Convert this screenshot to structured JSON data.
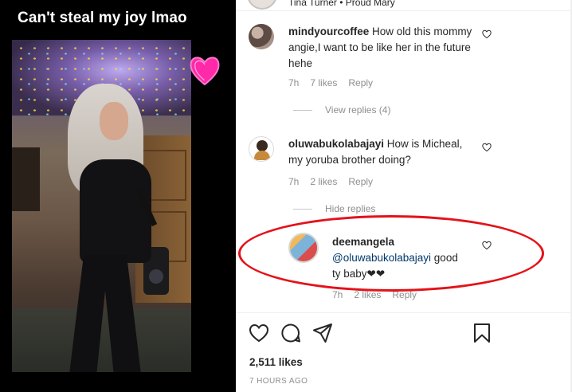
{
  "media": {
    "caption": "Can't steal my joy lmao"
  },
  "header": {
    "subtitle": "Tina Turner • Proud Mary"
  },
  "comments": [
    {
      "username": "mindyourcoffee",
      "text": "How old this mommy angie,I want to be like her in the future hehe",
      "time": "7h",
      "likes": "7 likes",
      "reply": "Reply",
      "replies_toggle": "View replies (4)"
    },
    {
      "username": "oluwabukolabajayi",
      "text": "How is Micheal, my yoruba brother doing?",
      "time": "7h",
      "likes": "2 likes",
      "reply": "Reply",
      "replies_toggle": "Hide replies"
    }
  ],
  "reply": {
    "username": "deemangela",
    "mention": "@oluwabukolabajayi",
    "text": "good ty baby❤❤",
    "time": "7h",
    "likes": "2 likes",
    "reply": "Reply"
  },
  "post": {
    "likes": "2,511 likes",
    "time_ago": "7 HOURS AGO"
  },
  "colors": {
    "annotation": "#e4121a",
    "text": "#262626",
    "secondary": "#8e8e8e",
    "mention": "#00376b"
  }
}
